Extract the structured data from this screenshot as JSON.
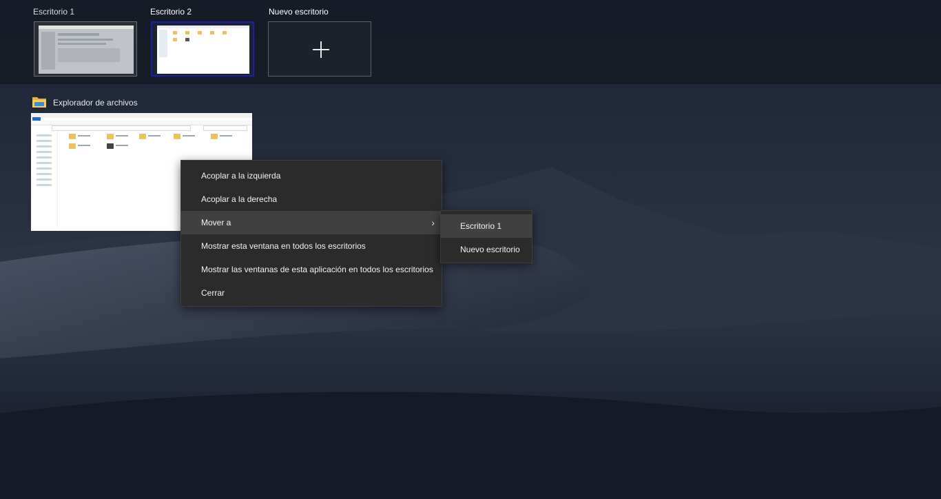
{
  "desktops": [
    {
      "label": "Escritorio 1",
      "active": false
    },
    {
      "label": "Escritorio 2",
      "active": true
    }
  ],
  "new_desktop": {
    "label": "Nuevo escritorio",
    "icon": "plus-icon"
  },
  "window_group": {
    "app_title": "Explorador de archivos",
    "icon": "folder-icon"
  },
  "context_menu": {
    "items": [
      {
        "label": "Acoplar a la izquierda"
      },
      {
        "label": "Acoplar a la derecha"
      },
      {
        "label": "Mover a",
        "has_submenu": true,
        "highlighted": true
      },
      {
        "label": "Mostrar esta ventana en todos los escritorios"
      },
      {
        "label": "Mostrar las ventanas de esta aplicación en todos los escritorios"
      },
      {
        "label": "Cerrar"
      }
    ],
    "submenu_indicator": "chevron-right-icon"
  },
  "submenu": {
    "items": [
      {
        "label": "Escritorio 1",
        "highlighted": true
      },
      {
        "label": "Nuevo escritorio"
      }
    ]
  },
  "colors": {
    "active_desktop_border": "#1e1ea8",
    "menu_background": "#2b2b2b",
    "menu_highlight": "#414141"
  }
}
